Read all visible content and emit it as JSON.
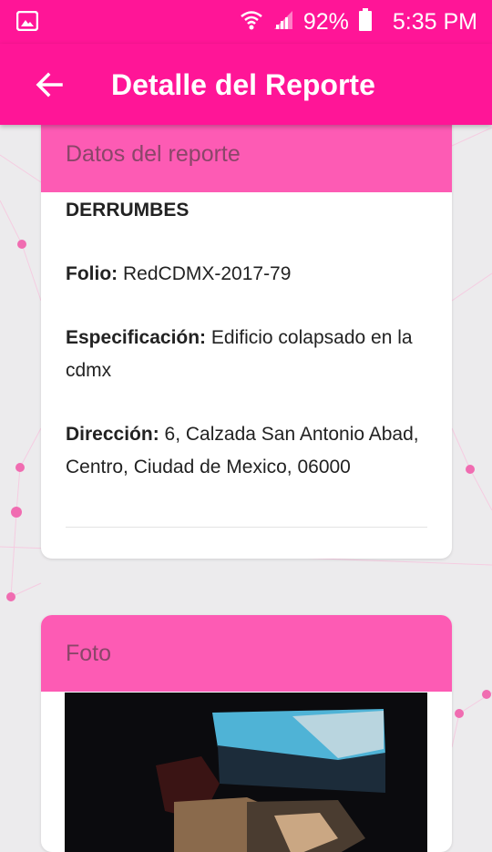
{
  "status_bar": {
    "battery_percent": "92%",
    "time": "5:35 PM",
    "icons": [
      "image-icon",
      "wifi-icon",
      "signal-icon",
      "battery-icon"
    ]
  },
  "app_bar": {
    "title": "Detalle del Reporte",
    "back_icon": "arrow-back-icon"
  },
  "report_card": {
    "header": "Datos del reporte",
    "type": "DERRUMBES",
    "folio_label": "Folio:",
    "folio_value": "RedCDMX-2017-79",
    "spec_label": "Especificación:",
    "spec_value": "Edificio colapsado en la cdmx",
    "address_label": "Dirección:",
    "address_value": "6, Calzada San Antonio Abad, Centro, Ciudad de Mexico, 06000"
  },
  "photo_card": {
    "header": "Foto"
  },
  "colors": {
    "primary": "#ff1597",
    "card_header": "#fd5bb4",
    "header_text": "#8a4669",
    "background": "#ecebed"
  }
}
